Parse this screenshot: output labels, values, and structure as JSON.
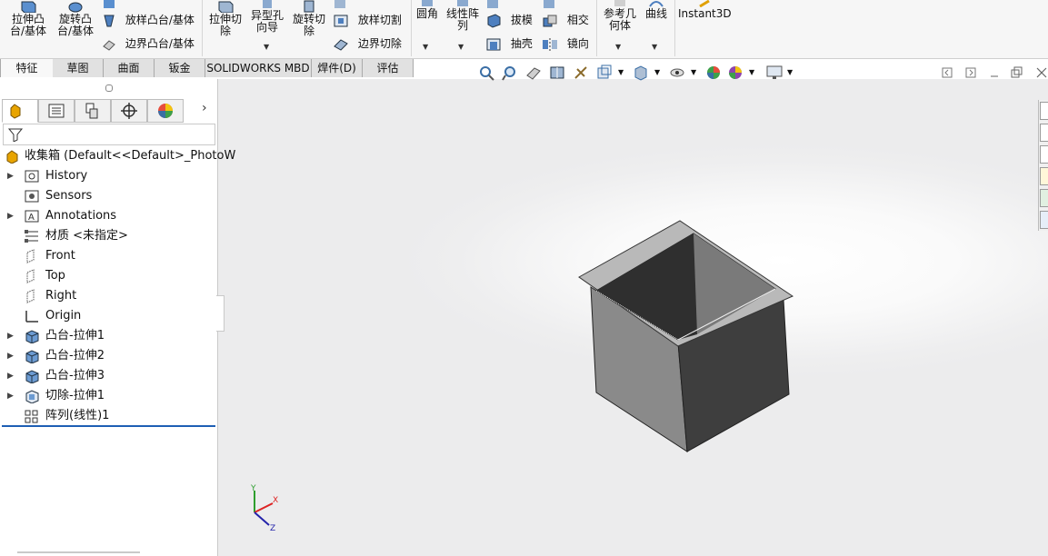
{
  "ribbon": {
    "extrude_boss": "拉伸凸\n台/基体",
    "revolve_boss": "旋转凸\n台/基体",
    "loft_boss": "放样凸台/基体",
    "boundary_boss": "边界凸台/基体",
    "extrude_cut": "拉伸切\n除",
    "hole_wizard": "异型孔\n向导",
    "revolve_cut": "旋转切\n除",
    "loft_cut": "放样切割",
    "boundary_cut": "边界切除",
    "fillet": "圆角",
    "linear_pattern": "线性阵\n列",
    "draft": "拔模",
    "shell": "抽壳",
    "intersect": "相交",
    "mirror": "镜向",
    "ref_geometry": "参考几\n何体",
    "curves": "曲线",
    "instant3d": "Instant3D"
  },
  "tabs": [
    "特征",
    "草图",
    "曲面",
    "钣金",
    "SOLIDWORKS MBD",
    "焊件(D)",
    "评估"
  ],
  "tree": {
    "root": "收集箱  (Default<<Default>_PhotoW",
    "items": [
      {
        "label": "History",
        "icon": "history-icon",
        "expandable": true
      },
      {
        "label": "Sensors",
        "icon": "sensors-icon",
        "expandable": false
      },
      {
        "label": "Annotations",
        "icon": "annotations-icon",
        "expandable": true
      },
      {
        "label": "材质 <未指定>",
        "icon": "material-icon",
        "expandable": false
      },
      {
        "label": "Front",
        "icon": "plane-icon",
        "expandable": false
      },
      {
        "label": "Top",
        "icon": "plane-icon",
        "expandable": false
      },
      {
        "label": "Right",
        "icon": "plane-icon",
        "expandable": false
      },
      {
        "label": "Origin",
        "icon": "origin-icon",
        "expandable": false
      },
      {
        "label": "凸台-拉伸1",
        "icon": "extrude-feature-icon",
        "expandable": true
      },
      {
        "label": "凸台-拉伸2",
        "icon": "extrude-feature-icon",
        "expandable": true
      },
      {
        "label": "凸台-拉伸3",
        "icon": "extrude-feature-icon",
        "expandable": true
      },
      {
        "label": "切除-拉伸1",
        "icon": "cut-feature-icon",
        "expandable": true
      },
      {
        "label": "阵列(线性)1",
        "icon": "linear-pattern-icon",
        "expandable": false
      }
    ]
  },
  "triad": {
    "x": "X",
    "y": "Y",
    "z": "Z"
  },
  "colors": {
    "accent_blue": "#1e5fb4",
    "part_face_light": "#8a8a8a",
    "part_face_dark": "#3e3e3e",
    "part_rim": "#b9b9b9"
  }
}
